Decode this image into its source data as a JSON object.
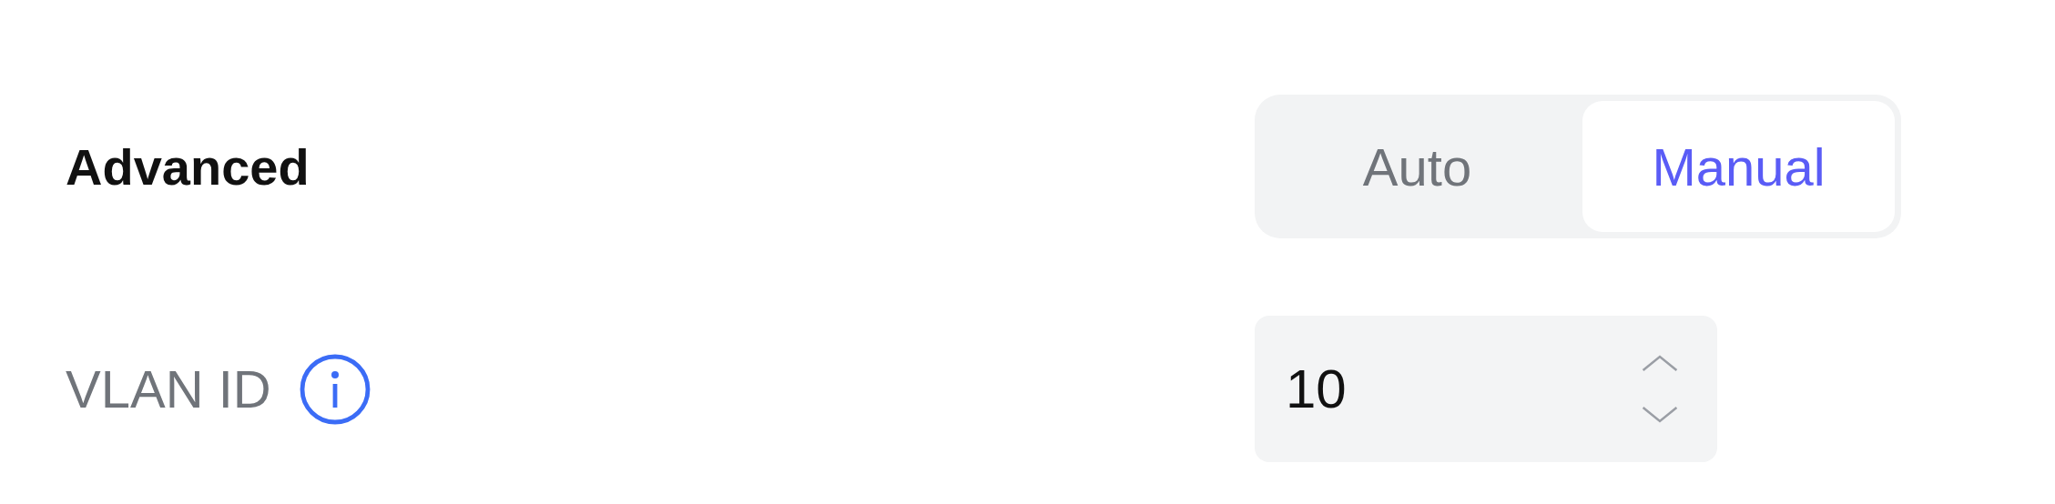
{
  "advanced": {
    "title": "Advanced",
    "mode_options": [
      {
        "label": "Auto",
        "selected": false
      },
      {
        "label": "Manual",
        "selected": true
      }
    ]
  },
  "vlan_id": {
    "label": "VLAN ID",
    "value": "10"
  }
}
